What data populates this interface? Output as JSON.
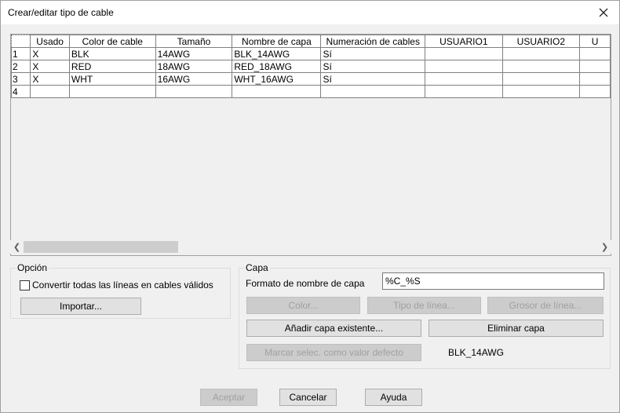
{
  "window": {
    "title": "Crear/editar tipo de cable",
    "close_glyph": "✕"
  },
  "grid": {
    "columns": [
      "Usado",
      "Color de cable",
      "Tamaño",
      "Nombre de capa",
      "Numeración de cables",
      "USUARIO1",
      "USUARIO2",
      "U"
    ],
    "rows": [
      {
        "num": "1",
        "usado": "X",
        "color": "BLK",
        "tamano": "14AWG",
        "capa": "BLK_14AWG",
        "numeracion": "Sí",
        "usuario1": "",
        "usuario2": "",
        "u": ""
      },
      {
        "num": "2",
        "usado": "X",
        "color": "RED",
        "tamano": "18AWG",
        "capa": "RED_18AWG",
        "numeracion": "Sí",
        "usuario1": "",
        "usuario2": "",
        "u": ""
      },
      {
        "num": "3",
        "usado": "X",
        "color": "WHT",
        "tamano": "16AWG",
        "capa": "WHT_16AWG",
        "numeracion": "Sí",
        "usuario1": "",
        "usuario2": "",
        "u": ""
      },
      {
        "num": "4",
        "usado": "",
        "color": "",
        "tamano": "",
        "capa": "",
        "numeracion": "",
        "usuario1": "",
        "usuario2": "",
        "u": ""
      }
    ]
  },
  "opcion": {
    "title": "Opción",
    "checkbox_label": "Convertir todas las líneas en cables válidos",
    "checked": false,
    "import_button": "Importar..."
  },
  "capa": {
    "title": "Capa",
    "format_label": "Formato de nombre de capa",
    "format_value": "%C_%S",
    "color_button": "Color...",
    "linetype_button": "Tipo de línea...",
    "lineweight_button": "Grosor de línea...",
    "add_existing_button": "Añadir capa existente...",
    "delete_button": "Eliminar capa",
    "mark_default_button": "Marcar selec. como valor defecto",
    "default_value": "BLK_14AWG"
  },
  "footer": {
    "accept": "Aceptar",
    "cancel": "Cancelar",
    "help": "Ayuda"
  }
}
